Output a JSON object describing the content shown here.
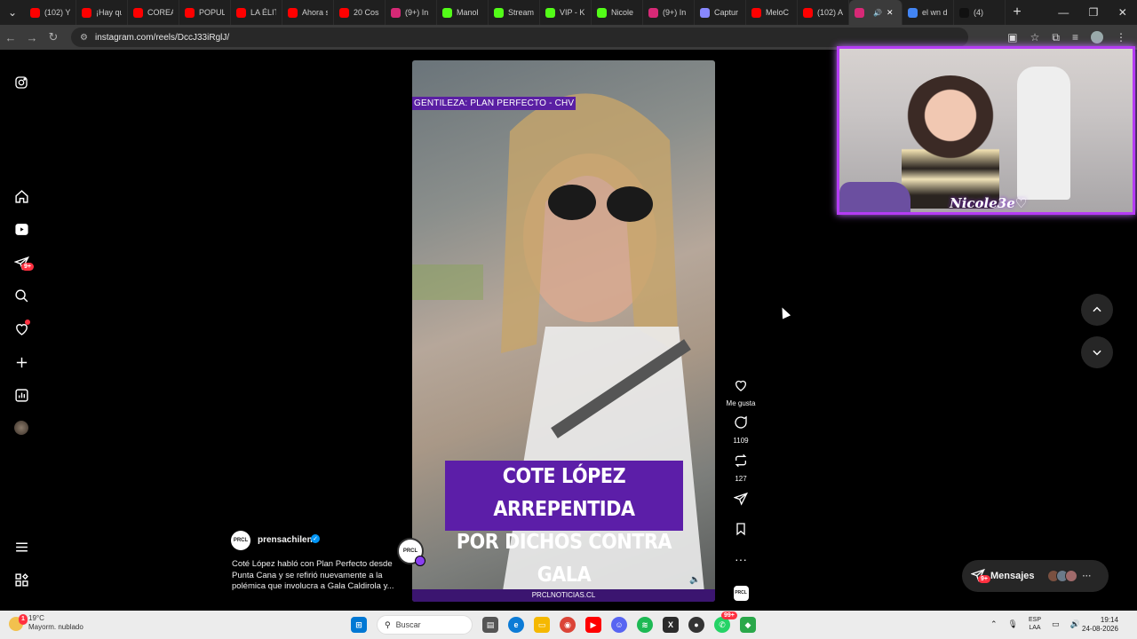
{
  "browser": {
    "tabs": [
      {
        "label": "(102) Y",
        "icon": "youtube-icon",
        "color": "#ff0000"
      },
      {
        "label": "¡Hay qu",
        "icon": "youtube-icon",
        "color": "#ff0000"
      },
      {
        "label": "COREA",
        "icon": "youtube-icon",
        "color": "#ff0000"
      },
      {
        "label": "POPUL",
        "icon": "youtube-icon",
        "color": "#ff0000"
      },
      {
        "label": "LA ÉLIT",
        "icon": "youtube-icon",
        "color": "#ff0000"
      },
      {
        "label": "Ahora s",
        "icon": "youtube-icon",
        "color": "#ff0000"
      },
      {
        "label": "20 Cos",
        "icon": "youtube-icon",
        "color": "#ff0000"
      },
      {
        "label": "(9+) In",
        "icon": "instagram-icon",
        "color": "#d62976"
      },
      {
        "label": "Manol",
        "icon": "kick-icon",
        "color": "#53fc18"
      },
      {
        "label": "Stream",
        "icon": "kick-icon",
        "color": "#53fc18"
      },
      {
        "label": "VIP - K",
        "icon": "kick-icon",
        "color": "#53fc18"
      },
      {
        "label": "Nicole",
        "icon": "kick-icon",
        "color": "#53fc18"
      },
      {
        "label": "(9+) In",
        "icon": "instagram-icon",
        "color": "#d62976"
      },
      {
        "label": "Captur",
        "icon": "pen-icon",
        "color": "#8888ff"
      },
      {
        "label": "MeloC",
        "icon": "youtube-icon",
        "color": "#ff0000"
      },
      {
        "label": "(102) A",
        "icon": "youtube-icon",
        "color": "#ff0000"
      },
      {
        "label": "",
        "icon": "instagram-icon",
        "color": "#d62976",
        "active": true
      },
      {
        "label": "el wn d",
        "icon": "google-icon",
        "color": "#4285f4"
      },
      {
        "label": "(4)",
        "icon": "tiktok-icon",
        "color": "#111111"
      }
    ],
    "url": "instagram.com/reels/DccJ33iRglJ/"
  },
  "sidebar": {
    "notifications_badge": "9+"
  },
  "reel": {
    "credit_overlay": "GENTILEZA: PLAN PERFECTO - CHV",
    "headline_line1": "COTE LÓPEZ ARREPENTIDA",
    "headline_line2": "POR DICHOS CONTRA GALA",
    "footer": "PRCLNOTICIAS.CL",
    "author": "prensachilena",
    "avatar_text": "PRCL",
    "caption": "Coté López habló con Plan Perfecto desde Punta Cana y se refirió nuevamente a la polémica que involucra a Gala Caldirola y..."
  },
  "actions": {
    "like_label": "Me gusta",
    "comments": "1109",
    "reposts": "127"
  },
  "webcam": {
    "name": "Nicole3e♡"
  },
  "messages": {
    "label": "Mensajes",
    "badge": "9+"
  },
  "taskbar": {
    "temperature": "19°C",
    "weather_desc": "Mayorm. nublado",
    "weather_badge": "1",
    "search_placeholder": "Buscar",
    "lang1": "ESP",
    "lang2": "LAA",
    "time": "19:14",
    "date": "24-08-2026",
    "whatsapp_badge": "99+"
  }
}
